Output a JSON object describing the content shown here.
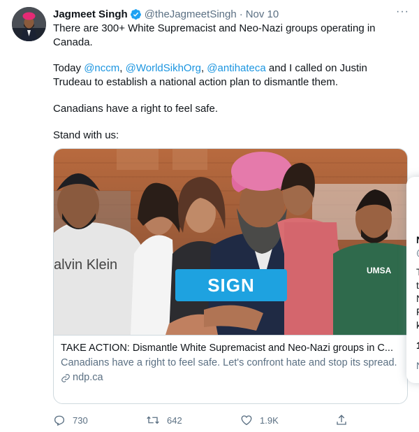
{
  "author": {
    "name": "Jagmeet Singh",
    "handle": "@theJagmeetSingh",
    "date": "Nov 10",
    "separator": "·"
  },
  "more_label": "···",
  "tweet": {
    "line1": "There are 300+ White Supremacist and Neo-Nazi groups operating in Canada.",
    "line2_prefix": "Today ",
    "mentions": [
      "@nccm",
      "@WorldSikhOrg",
      "@antihateca"
    ],
    "line2_sep1": ", ",
    "line2_sep2": ", ",
    "line2_suffix": " and I called on Justin Trudeau to establish a national action plan to dismantle them.",
    "line3": "Canadians have a right to feel safe.",
    "line4": "Stand with us:"
  },
  "card": {
    "image_button": "SIGN",
    "image_shirt_text": "alvin Klein",
    "title": "TAKE ACTION: Dismantle White Supremacist and Neo-Nazi groups in C...",
    "description": "Canadians have a right to feel safe. Let's confront hate and stop its spread.",
    "domain": "ndp.ca"
  },
  "actions": {
    "replies": "730",
    "retweets": "642",
    "likes": "1.9K"
  },
  "popup_fragments": [
    "N",
    "@",
    "T",
    "t",
    "N",
    "F",
    "k",
    "1",
    "N"
  ],
  "colors": {
    "link": "#1b95e0",
    "muted": "#5b7083",
    "sign_button": "#1ea2e0",
    "verified": "#1da1f2"
  }
}
